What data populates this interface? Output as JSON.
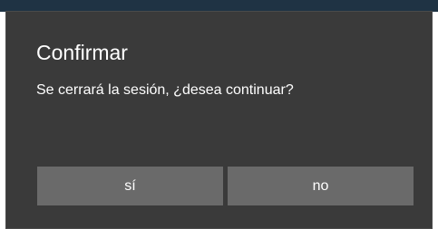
{
  "dialog": {
    "title": "Confirmar",
    "message": "Se cerrará la sesión, ¿desea continuar?",
    "buttons": {
      "yes_label": "sí",
      "no_label": "no"
    }
  },
  "colors": {
    "dialog_background": "#3a3a3a",
    "button_background": "#6a6a6a",
    "text": "#ffffff",
    "topbar": "#1f3344"
  }
}
